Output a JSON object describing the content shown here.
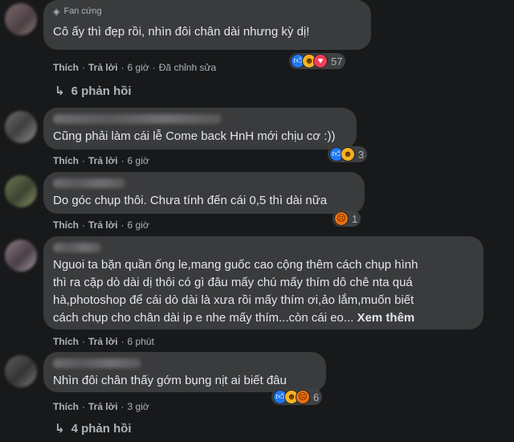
{
  "comments": [
    {
      "badge": "Fan cứng",
      "text": "Cô ấy thì đẹp rồi, nhìn đôi chân dài nhưng kỳ dị!",
      "like": "Thích",
      "reply": "Trả lời",
      "time": "6 giờ",
      "edited": "Đã chỉnh sửa",
      "reactions": [
        "like",
        "haha",
        "love"
      ],
      "reaction_count": "57",
      "replies_label": "6 phản hồi"
    },
    {
      "text": "Cũng phải làm cái lễ Come back HnH mới chịu cơ :))",
      "like": "Thích",
      "reply": "Trả lời",
      "time": "6 giờ",
      "reactions": [
        "like",
        "haha"
      ],
      "reaction_count": "3"
    },
    {
      "text": "Do góc chụp thôi. Chưa tính đến cái 0,5 thì dài nữa",
      "like": "Thích",
      "reply": "Trả lời",
      "time": "6 giờ",
      "reactions": [
        "angry"
      ],
      "reaction_count": "1"
    },
    {
      "text_lines": [
        "Nguoi ta bặn quần ống le,mang guốc cao cộng thêm cách chụp hình",
        "thì ra cặp dò dài dị thôi có gì đâu mấy chú mấy thím dô chê nta quá",
        "hà,photoshop để cái dò dài là xưa rồi mấy thím ơi,ảo lắm,muốn biết",
        "cách chụp cho chân dài ip e nhe mấy thím...còn cái eo..."
      ],
      "see_more": "Xem thêm",
      "like": "Thích",
      "reply": "Trả lời",
      "time": "6 phút"
    },
    {
      "text": "Nhìn đôi chân thấy gớm bụng nịt ai biết đâu",
      "like": "Thích",
      "reply": "Trả lời",
      "time": "3 giờ",
      "reactions": [
        "like",
        "haha",
        "angry"
      ],
      "reaction_count": "6",
      "replies_label": "4 phản hồi"
    }
  ],
  "colors": {
    "background": "#18191a",
    "bubble": "#3a3b3c",
    "text": "#e4e6eb",
    "muted": "#b0b3b8"
  },
  "icons": {
    "badge": "diamond-icon",
    "reply_arrow": "reply-arrow-icon",
    "like": "like-icon",
    "haha": "haha-icon",
    "love": "love-icon",
    "angry": "angry-icon"
  }
}
